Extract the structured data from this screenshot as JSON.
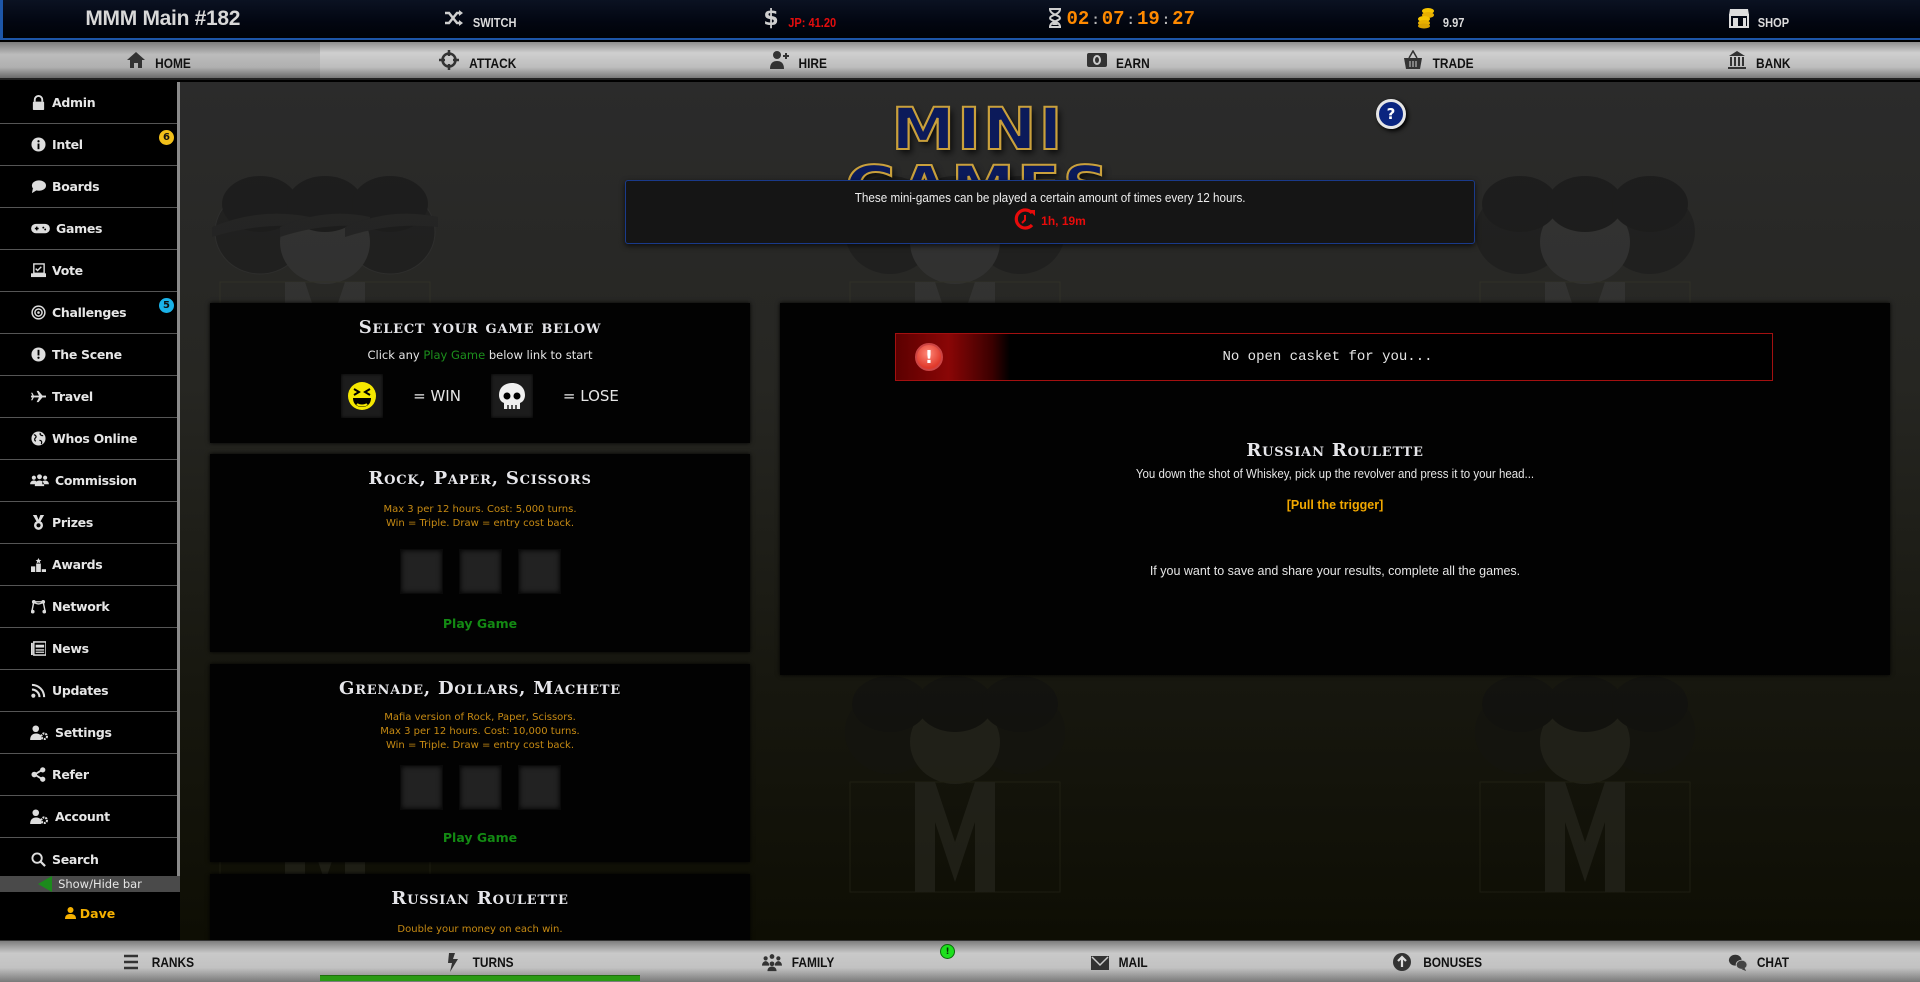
{
  "topbar": {
    "title": "MMM Main #182",
    "switch_label": "SWITCH",
    "jackpot": "JP: 41.20",
    "timer": [
      "02",
      "07",
      "19",
      "27"
    ],
    "coins": "9.97",
    "shop_label": "SHOP"
  },
  "nav": {
    "items": [
      {
        "label": "HOME",
        "icon": "home-icon"
      },
      {
        "label": "ATTACK",
        "icon": "crosshair-icon"
      },
      {
        "label": "HIRE",
        "icon": "user-plus-icon"
      },
      {
        "label": "EARN",
        "icon": "money-icon"
      },
      {
        "label": "TRADE",
        "icon": "basket-icon"
      },
      {
        "label": "BANK",
        "icon": "bank-icon"
      }
    ],
    "active": "HOME"
  },
  "sidebar": {
    "items": [
      {
        "label": "Admin",
        "icon": "lock-icon"
      },
      {
        "label": "Intel",
        "icon": "info-icon",
        "badge": "6",
        "badge_color": "#f2c01a"
      },
      {
        "label": "Boards",
        "icon": "speech-bubble-icon"
      },
      {
        "label": "Games",
        "icon": "gamepad-icon"
      },
      {
        "label": "Vote",
        "icon": "ballot-icon"
      },
      {
        "label": "Challenges",
        "icon": "target-icon",
        "badge": "5",
        "badge_color": "#1ab2e8"
      },
      {
        "label": "The Scene",
        "icon": "exclamation-icon"
      },
      {
        "label": "Travel",
        "icon": "plane-icon"
      },
      {
        "label": "Whos Online",
        "icon": "globe-icon"
      },
      {
        "label": "Commission",
        "icon": "users-icon"
      },
      {
        "label": "Prizes",
        "icon": "medal-icon"
      },
      {
        "label": "Awards",
        "icon": "podium-icon"
      },
      {
        "label": "Network",
        "icon": "network-icon"
      },
      {
        "label": "News",
        "icon": "newspaper-icon"
      },
      {
        "label": "Updates",
        "icon": "rss-icon"
      },
      {
        "label": "Settings",
        "icon": "user-gear-icon"
      },
      {
        "label": "Refer",
        "icon": "share-icon"
      },
      {
        "label": "Account",
        "icon": "user-gear-icon"
      },
      {
        "label": "Search",
        "icon": "search-icon"
      }
    ],
    "show_hide_label": "Show/Hide bar",
    "username": "Dave"
  },
  "main": {
    "page_title": "MINI GAMES",
    "help_label": "?",
    "info_text": "These mini-games can be played a certain amount of times every 12 hours.",
    "reset_time": "1h, 19m",
    "select_panel": {
      "title": "Select your game below",
      "instr_before": "Click any ",
      "instr_link": "Play Game",
      "instr_after": " below link to start",
      "win_label": "= WIN",
      "lose_label": "= LOSE"
    },
    "games": [
      {
        "title": "Rock, Paper, Scissors",
        "lines": [
          "Max 3 per 12 hours. Cost: 5,000 turns.",
          "Win = Triple. Draw = entry cost back."
        ],
        "play_label": "Play Game"
      },
      {
        "title": "Grenade, Dollars, Machete",
        "lines": [
          "Mafia version of Rock, Paper, Scissors.",
          "Max 3 per 12 hours. Cost: 10,000 turns.",
          "Win = Triple. Draw = entry cost back."
        ],
        "play_label": "Play Game"
      },
      {
        "title": "Russian Roulette",
        "lines": [
          "Double your money on each win."
        ]
      }
    ],
    "result_panel": {
      "alert": "No open casket for you...",
      "title": "Russian Roulette",
      "description": "You down the shot of Whiskey, pick up the revolver and press it to your head...",
      "action": "[Pull the trigger]",
      "note": "If you want to save and share your results, complete all the games."
    }
  },
  "bottombar": {
    "items": [
      {
        "label": "RANKS",
        "icon": "list-icon"
      },
      {
        "label": "TURNS",
        "icon": "lightning-icon"
      },
      {
        "label": "FAMILY",
        "icon": "family-icon"
      },
      {
        "label": "MAIL",
        "icon": "mail-icon"
      },
      {
        "label": "BONUSES",
        "icon": "arrow-up-circle-icon"
      },
      {
        "label": "CHAT",
        "icon": "chat-icon"
      }
    ],
    "turns_progress": 1.0,
    "notification": "!"
  }
}
